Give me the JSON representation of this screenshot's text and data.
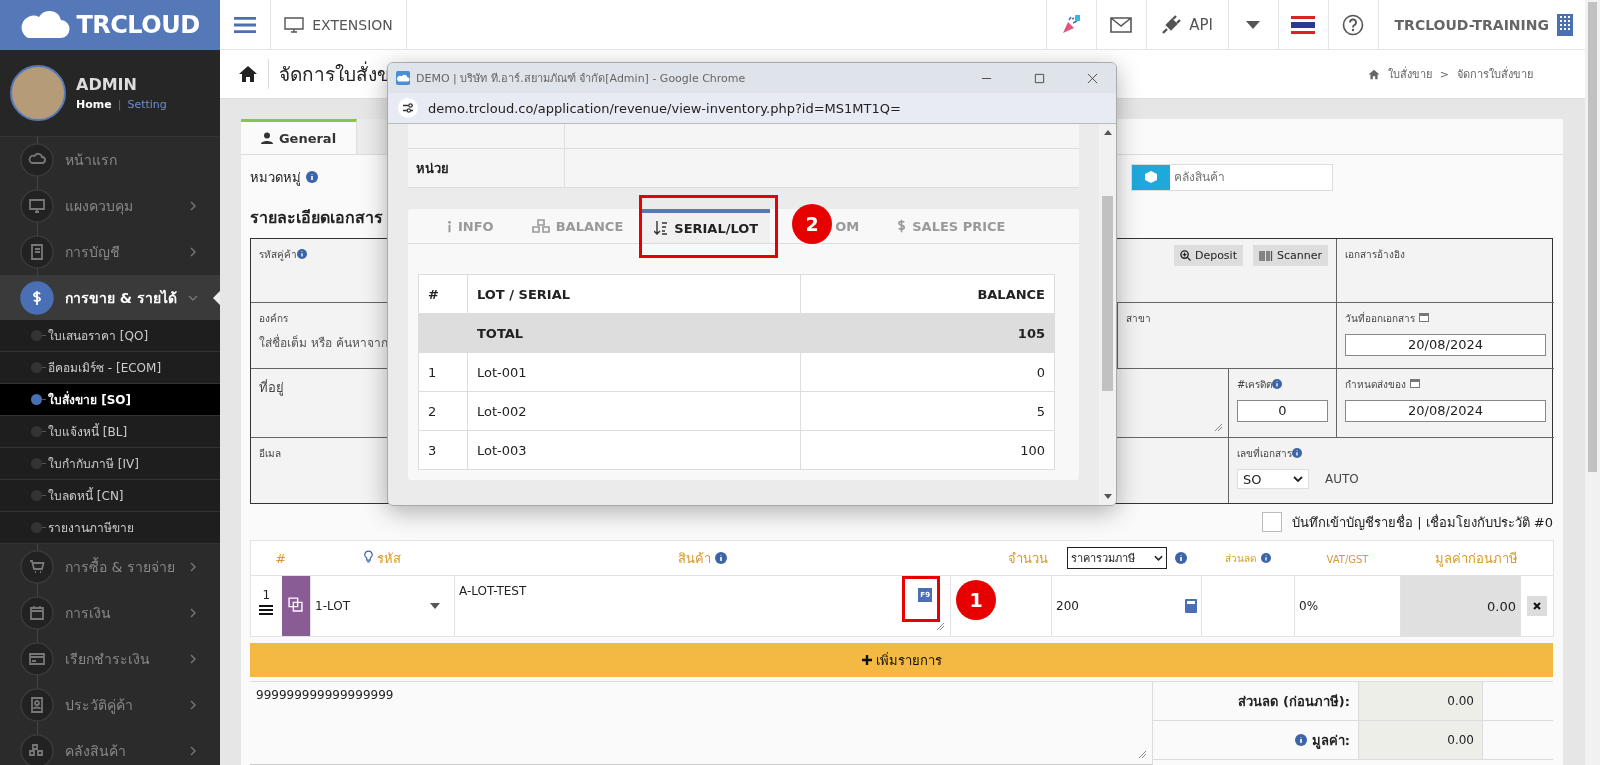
{
  "topbar": {
    "logo": "TRCLOUD",
    "menu_label": "EXTENSION",
    "api_label": "API",
    "account": "TRCLOUD-TRAINING"
  },
  "user": {
    "name": "ADMIN",
    "home_link": "Home",
    "separator": "|",
    "setting_link": "Setting"
  },
  "sidebar": {
    "items": [
      {
        "label": "หน้าแรก",
        "kind": "link",
        "selected": false
      },
      {
        "label": "แผงควบคุม",
        "kind": "menu",
        "selected": false,
        "expanded": false
      },
      {
        "label": "การบัญชี",
        "kind": "menu",
        "selected": false,
        "expanded": false
      },
      {
        "label": "การขาย & รายได้",
        "kind": "menu",
        "selected": true,
        "expanded": true,
        "children": [
          {
            "label": "ใบเสนอราคา [QO]",
            "selected": false
          },
          {
            "label": "อีคอมเมิร์ซ - [ECOM]",
            "selected": false
          },
          {
            "label": "ใบสั่งขาย [SO]",
            "selected": true
          },
          {
            "label": "ใบแจ้งหนี้ [BL]",
            "selected": false
          },
          {
            "label": "ใบกำกับภาษี [IV]",
            "selected": false
          },
          {
            "label": "ใบลดหนี้ [CN]",
            "selected": false
          },
          {
            "label": "รายงานภาษีขาย",
            "selected": false
          }
        ]
      },
      {
        "label": "การซื้อ & รายจ่าย",
        "kind": "menu",
        "selected": false,
        "expanded": false
      },
      {
        "label": "การเงิน",
        "kind": "menu",
        "selected": false,
        "expanded": false
      },
      {
        "label": "เรียกชำระเงิน",
        "kind": "menu",
        "selected": false,
        "expanded": false
      },
      {
        "label": "ประวัติคู่ค้า",
        "kind": "menu",
        "selected": false,
        "expanded": false
      },
      {
        "label": "คลังสินค้า",
        "kind": "menu",
        "selected": false,
        "expanded": false
      }
    ]
  },
  "header": {
    "title": "จัดการใบสั่งข",
    "breadcrumb": [
      "ใบสั่งขาย",
      "จัดการใบสั่งขาย"
    ],
    "breadcrumb_separator": ">"
  },
  "main_tabs": [
    {
      "label": "General",
      "selected": true
    },
    {
      "selected": false
    }
  ],
  "form": {
    "category_label": "หมวดหมู่",
    "warehouse_placeholder": "คลังสินค้า",
    "section_title": "รายละเอียดเอกสาร",
    "customer_code_label": "รหัสคู่ค้า",
    "deposit_button": "Deposit",
    "scanner_button": "Scanner",
    "reference_label": "เอกสารอ้างอิง",
    "organization_label": "องค์กร",
    "organization_placeholder": "ใส่ชื่อเต็ม หรือ ค้นหาจาก",
    "branch_label": "สาขา",
    "issue_date_label": "วันที่ออกเอกสาร",
    "issue_date": "20/08/2024",
    "address_label": "ที่อยู่",
    "credit_label": "#เครดิต",
    "credit": "0",
    "due_date_label": "กำหนดส่งของ",
    "due_date": "20/08/2024",
    "email_label": "อีเมล",
    "doc_no_label": "เลขที่เอกสาร",
    "doc_prefix": "SO",
    "doc_auto": "AUTO"
  },
  "ledger_checkbox": {
    "label": "บันทึกเข้าบัญชีรายชื่อ | เชื่อมโยงกับประวัติ #0",
    "checked": false
  },
  "items_table": {
    "columns": [
      "#",
      "รหัส",
      "สินค้า",
      "จำนวน",
      "ส่วนลด",
      "VAT/GST",
      "มูลค่าก่อนภาษี"
    ],
    "price_mode": "ราคารวมภาษี",
    "rows": [
      {
        "no": "1",
        "code": "1-LOT",
        "product": "A-LOT-TEST",
        "shortcut": "F9",
        "quantity": "200",
        "vat": "0%",
        "amount": "0.00"
      }
    ],
    "add_button": "เพิ่มรายการ"
  },
  "notes": "999999999999999999",
  "summary": [
    {
      "label": "ส่วนลด (ก่อนภาษี):",
      "value": "0.00",
      "info": false
    },
    {
      "label": "มูลค่า:",
      "value": "0.00",
      "info": true
    }
  ],
  "popup": {
    "title": "DEMO | บริษัท ที.อาร์.สยามภัณฑ์ จำกัด[Admin] - Google Chrome",
    "url": "demo.trcloud.co/application/revenue/view-inventory.php?id=MS1MT1Q=",
    "unit_label": "หน่วย",
    "tabs": [
      {
        "label": "INFO",
        "selected": false
      },
      {
        "label": "BALANCE",
        "selected": false
      },
      {
        "label": "SERIAL/LOT",
        "selected": true
      },
      {
        "label": "OM",
        "selected": false
      },
      {
        "label": "SALES PRICE",
        "selected": false
      }
    ],
    "lot_table": {
      "columns": [
        "#",
        "LOT / SERIAL",
        "BALANCE"
      ],
      "total": {
        "label": "TOTAL",
        "value": "105"
      },
      "rows": [
        {
          "no": "1",
          "lot": "Lot-001",
          "balance": "0"
        },
        {
          "no": "2",
          "lot": "Lot-002",
          "balance": "5"
        },
        {
          "no": "3",
          "lot": "Lot-003",
          "balance": "100"
        }
      ]
    }
  },
  "annotations": [
    {
      "label": "1"
    },
    {
      "label": "2"
    }
  ]
}
